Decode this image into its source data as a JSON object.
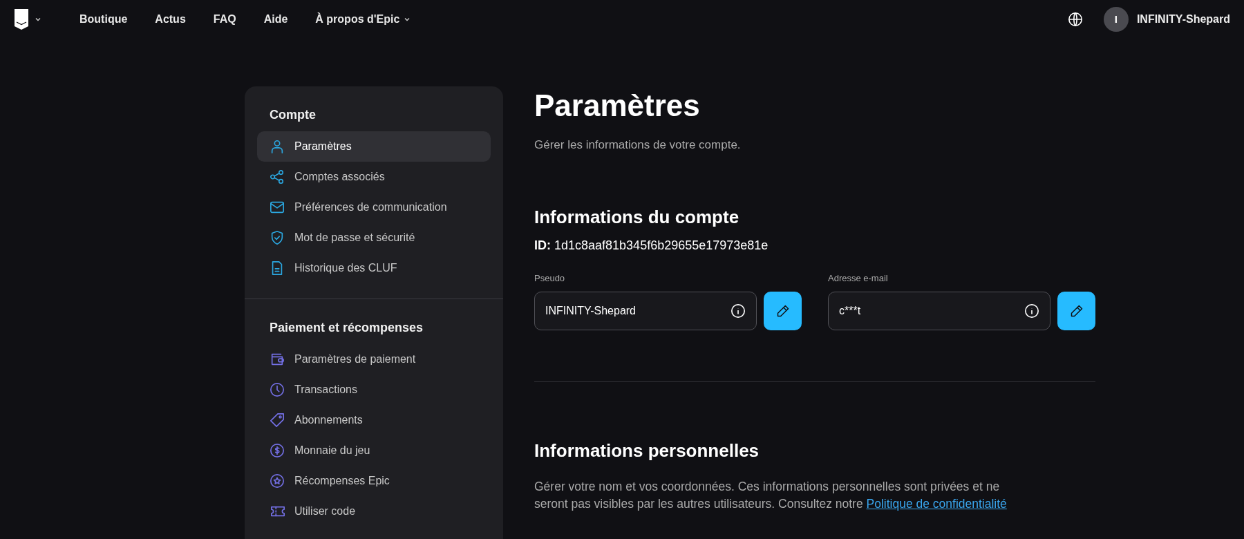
{
  "nav": {
    "links": [
      "Boutique",
      "Actus",
      "FAQ",
      "Aide",
      "À propos d'Epic"
    ],
    "user": {
      "initial": "I",
      "name": "INFINITY-Shepard"
    }
  },
  "sidebar": {
    "groups": [
      {
        "title": "Compte",
        "items": [
          {
            "label": "Paramètres",
            "selected": true
          },
          {
            "label": "Comptes associés",
            "selected": false
          },
          {
            "label": "Préférences de communication",
            "selected": false
          },
          {
            "label": "Mot de passe et sécurité",
            "selected": false
          },
          {
            "label": "Historique des CLUF",
            "selected": false
          }
        ]
      },
      {
        "title": "Paiement et récompenses",
        "items": [
          {
            "label": "Paramètres de paiement",
            "selected": false
          },
          {
            "label": "Transactions",
            "selected": false
          },
          {
            "label": "Abonnements",
            "selected": false
          },
          {
            "label": "Monnaie du jeu",
            "selected": false
          },
          {
            "label": "Récompenses Epic",
            "selected": false
          },
          {
            "label": "Utiliser code",
            "selected": false
          }
        ]
      }
    ]
  },
  "page": {
    "title": "Paramètres",
    "subtitle": "Gérer les informations de votre compte.",
    "account": {
      "heading": "Informations du compte",
      "id_label": "ID:",
      "id_value": "1d1c8aaf81b345f6b29655e17973e81e",
      "fields": [
        {
          "label": "Pseudo",
          "value": "INFINITY-Shepard"
        },
        {
          "label": "Adresse e-mail",
          "value": "c***t"
        }
      ]
    },
    "personal": {
      "heading": "Informations personnelles",
      "text": "Gérer votre nom et vos coordonnées. Ces informations personnelles sont privées et ne seront pas visibles par les autres utilisateurs. Consultez notre",
      "link": "Politique de confidentialité"
    }
  }
}
